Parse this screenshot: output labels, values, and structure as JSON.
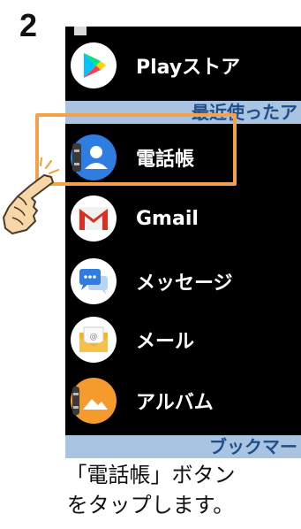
{
  "step": {
    "number": "2"
  },
  "apps": [
    {
      "label": "Playストア",
      "icon": "play-store-icon"
    },
    {
      "label": "電話帳",
      "icon": "contacts-icon"
    },
    {
      "label": "Gmail",
      "icon": "gmail-icon"
    },
    {
      "label": "メッセージ",
      "icon": "messages-icon"
    },
    {
      "label": "メール",
      "icon": "email-icon"
    },
    {
      "label": "アルバム",
      "icon": "album-icon"
    }
  ],
  "sections": {
    "recent": "最近使ったア",
    "bookmarks": "ブックマー"
  },
  "caption": {
    "line1": "「電話帳」ボタン",
    "line2": "をタップします。"
  },
  "colors": {
    "highlight": "#f5a04a",
    "section_bg": "#a8c4e0",
    "section_text": "#1f4e8a",
    "phone_bg": "#000000"
  }
}
